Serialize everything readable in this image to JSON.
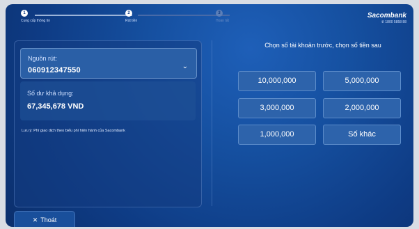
{
  "steps": [
    {
      "number": "1",
      "label": "Cung cấp thông tin"
    },
    {
      "number": "2",
      "label": "Rút tiền"
    },
    {
      "number": "3",
      "label": "Hoàn tất"
    }
  ],
  "brand": {
    "name": "Sacombank",
    "hotline": "1800 5858 88"
  },
  "source": {
    "label": "Nguồn rút:",
    "value": "060912347550"
  },
  "balance": {
    "label": "Số dư khả dụng:",
    "value": "67,345,678 VND"
  },
  "note": "Lưu ý: Phí giao dịch theo biểu phí hiện hành của Sacombank",
  "choose_title": "Chọn số tài khoản trước, chọn số tiền sau",
  "amounts": [
    "10,000,000",
    "5,000,000",
    "3,000,000",
    "2,000,000",
    "1,000,000",
    "Số khác"
  ],
  "exit": {
    "label": "Thoát"
  }
}
